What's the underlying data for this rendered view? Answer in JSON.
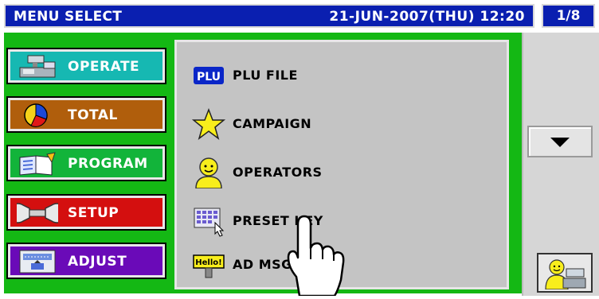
{
  "header": {
    "title": "MENU SELECT",
    "datetime": "21-JUN-2007(THU) 12:20",
    "page_indicator": "1/8"
  },
  "menu": [
    {
      "label": "OPERATE",
      "icon": "cash-register-icon",
      "color": "#16b8b2"
    },
    {
      "label": "TOTAL",
      "icon": "pie-chart-icon",
      "color": "#b05e0c"
    },
    {
      "label": "PROGRAM",
      "icon": "book-icon",
      "color": "#12b43a"
    },
    {
      "label": "SETUP",
      "icon": "wrench-icon",
      "color": "#d40f0f"
    },
    {
      "label": "ADJUST",
      "icon": "adjust-icon",
      "color": "#6a0ab8"
    }
  ],
  "items": [
    {
      "label": "PLU FILE",
      "icon": "plu-icon",
      "badge": "PLU"
    },
    {
      "label": "CAMPAIGN",
      "icon": "star-icon"
    },
    {
      "label": "OPERATORS",
      "icon": "operator-icon"
    },
    {
      "label": "PRESET KEY",
      "icon": "keyboard-icon"
    },
    {
      "label": "AD MSG",
      "icon": "hello-sign-icon",
      "badge": "Hello!"
    }
  ],
  "right": {
    "scroll_icon": "triangle-down-icon",
    "operator_icon": "operator-terminal-icon"
  },
  "colors": {
    "header": "#0a1fb0",
    "frame": "#14b814",
    "panel": "#c4c4c4"
  }
}
